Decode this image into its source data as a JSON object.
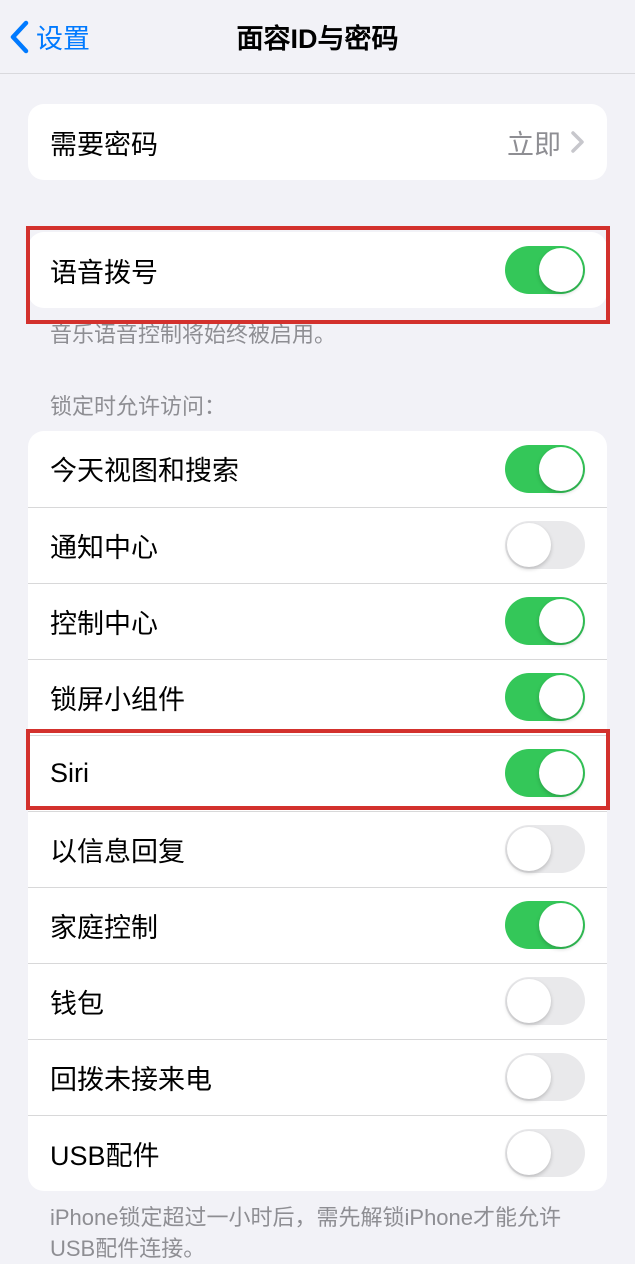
{
  "nav": {
    "back_label": "设置",
    "title": "面容ID与密码"
  },
  "passcode_group": {
    "require_passcode": {
      "label": "需要密码",
      "value": "立即"
    }
  },
  "voice_dial": {
    "label": "语音拨号",
    "footer": "音乐语音控制将始终被启用。"
  },
  "lock_access": {
    "header": "锁定时允许访问：",
    "items": [
      {
        "label": "今天视图和搜索",
        "on": true
      },
      {
        "label": "通知中心",
        "on": false
      },
      {
        "label": "控制中心",
        "on": true
      },
      {
        "label": "锁屏小组件",
        "on": true
      },
      {
        "label": "Siri",
        "on": true
      },
      {
        "label": "以信息回复",
        "on": false
      },
      {
        "label": "家庭控制",
        "on": true
      },
      {
        "label": "钱包",
        "on": false
      },
      {
        "label": "回拨未接来电",
        "on": false
      },
      {
        "label": "USB配件",
        "on": false
      }
    ],
    "footer": "iPhone锁定超过一小时后，需先解锁iPhone才能允许USB配件连接。"
  }
}
